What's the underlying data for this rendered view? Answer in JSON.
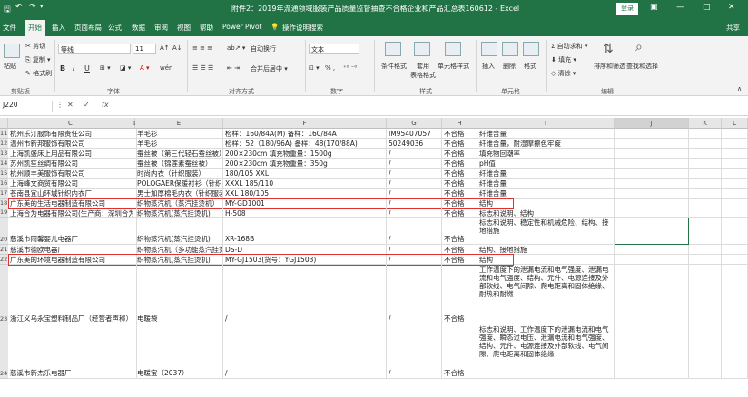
{
  "window": {
    "title": "附件2：2019年流通领域服装产品质量监督抽查不合格企业和产品汇总表160612  -  Excel",
    "login": "登录",
    "share": "共享",
    "qa_save": "🖫",
    "qa_undo": "↶",
    "qa_redo": "↷",
    "ctl_min": "—",
    "ctl_max": "□",
    "ctl_close": "✕"
  },
  "tabs": [
    "文件",
    "开始",
    "插入",
    "页面布局",
    "公式",
    "数据",
    "审阅",
    "视图",
    "帮助",
    "Power Pivot",
    "操作说明搜索"
  ],
  "ribbon": {
    "clipboard": {
      "paste": "粘贴",
      "cut": "✂ 剪切",
      "copy": "⎘ 复制 ▾",
      "painter": "✎ 格式刷",
      "label": "剪贴板"
    },
    "font": {
      "name": "等线",
      "size": "11",
      "grow": "A↑",
      "shrink": "A↓",
      "bold": "B",
      "italic": "I",
      "underline": "U",
      "phonetic": "wén",
      "label": "字体"
    },
    "align": {
      "wrap": "自动换行",
      "merge": "合并后居中 ▾",
      "label": "对齐方式"
    },
    "number": {
      "format": "文本",
      "pct": "% ,",
      "label": "数字"
    },
    "styles": {
      "cond": "条件格式",
      "table": "套用\n表格格式",
      "cell": "单元格样式",
      "label": "样式"
    },
    "cells": {
      "insert": "插入",
      "delete": "删除",
      "format": "格式",
      "label": "单元格"
    },
    "edit": {
      "autosum": "Σ 自动求和 ▾",
      "fill": "⬇ 填充 ▾",
      "clear": "◇ 清除 ▾",
      "sort": "排序和筛选",
      "find": "查找和选择",
      "label": "编辑"
    }
  },
  "formula_bar": {
    "name_box": "J220",
    "cancel": "✕",
    "enter": "✓",
    "fx": "fx",
    "value": ""
  },
  "columns": [
    "C",
    "D",
    "E",
    "F",
    "G",
    "H",
    "I",
    "J",
    "K",
    "L"
  ],
  "rows": [
    {
      "n": "11",
      "c": "杭州乐汀服饰有限责任公司",
      "e": "羊毛衫",
      "f": "检样：160/84A(M) 备样：160/84A",
      "g": "IM95407057",
      "h": "不合格",
      "i": "纤维含量"
    },
    {
      "n": "12",
      "c": "温州市新邦服饰有限公司",
      "e": "羊毛衫",
      "f": "检样：52（180/96A) 备样：48(170/88A)",
      "g": "50249036",
      "h": "不合格",
      "i": "纤维含量，耐湿摩擦色牢度"
    },
    {
      "n": "13",
      "c": "上海凯盛床上用品有限公司",
      "e": "蚕丝被（第三代轻石蚕丝被）",
      "f": "200×230cm 填充物重量：1500g",
      "g": "/",
      "h": "不合格",
      "i": "填充物回潮率"
    },
    {
      "n": "14",
      "c": "苏州凯笙丝绸有限公司",
      "e": "蚕丝被（锦莲素蚕丝被）",
      "f": "200×230cm 填充物重量：350g",
      "g": "/",
      "h": "不合格",
      "i": "pH值"
    },
    {
      "n": "15",
      "c": "杭州顺丰美服饰有限公司",
      "e": "时尚内衣（针织服装）",
      "f": "180/105 XXL",
      "g": "/",
      "h": "不合格",
      "i": "纤维含量"
    },
    {
      "n": "16",
      "c": "上海峰文商贸有限公司",
      "e": "POLOGAER保暖衬衫（针织服装）",
      "f": "XXXL 185/110",
      "g": "/",
      "h": "不合格",
      "i": "纤维含量"
    },
    {
      "n": "17",
      "c": "苍南县宜山环城针织内衣厂",
      "e": "男士加厚棉毛内衣（针织服装）",
      "f": "XXL 180/105",
      "g": "/",
      "h": "不合格",
      "i": "纤维含量"
    },
    {
      "n": "18",
      "c": "广东美的生活电器制造有限公司",
      "e": "织物蒸汽机（蒸汽挂烫机）",
      "f": "MY-GD1001",
      "g": "/",
      "h": "不合格",
      "i": "结构"
    },
    {
      "n": "19",
      "c": "上海合为电器有限公司(生产商：深圳合为家电有限公司)",
      "e": "织物蒸汽机(蒸汽挂烫机)",
      "f": "H-508",
      "g": "/",
      "h": "不合格",
      "i": "标志和说明、结构"
    },
    {
      "n": "20",
      "c": "慈溪市雨馨婴儿电器厂",
      "e": "织物蒸汽机(蒸汽挂烫机)",
      "f": "XR-168B",
      "g": "/",
      "h": "不合格",
      "i": "标志和说明、稳定性和机械危险、结构、接地措施"
    },
    {
      "n": "21",
      "c": "慈溪市德欧电器厂",
      "e": "织物蒸汽机（多功能蒸汽挂烫机）",
      "f": "DS-D",
      "g": "/",
      "h": "不合格",
      "i": "结构、接地措施"
    },
    {
      "n": "22",
      "c": "广东美的环境电器制造有限公司",
      "e": "织物蒸汽机(蒸汽挂烫机)",
      "f": "MY-GJ1503(货号：YGJ1503)",
      "g": "/",
      "h": "不合格",
      "i": "结构"
    },
    {
      "n": "23",
      "c": "浙江义乌永宝塑料制品厂（经营者声称）",
      "e": "电暖袋",
      "f": "/",
      "g": "/",
      "h": "不合格",
      "i": "工作温度下的泄漏电流和电气强度、泄漏电流和电气强度、结构、元件、电源连接及外部软线、电气间隙、爬电距离和固体绝缘、耐热和耐燃"
    },
    {
      "n": "24",
      "c": "慈溪市新杰乐电器厂",
      "e": "电暖宝（2037）",
      "f": "/",
      "g": "/",
      "h": "不合格",
      "i": "标志和说明、工作温度下的泄漏电流和电气强度、瞬态过电压、泄漏电流和电气强度、结构、元件、电源连接及外部软线、电气间隙、爬电距离和固体绝缘"
    }
  ]
}
